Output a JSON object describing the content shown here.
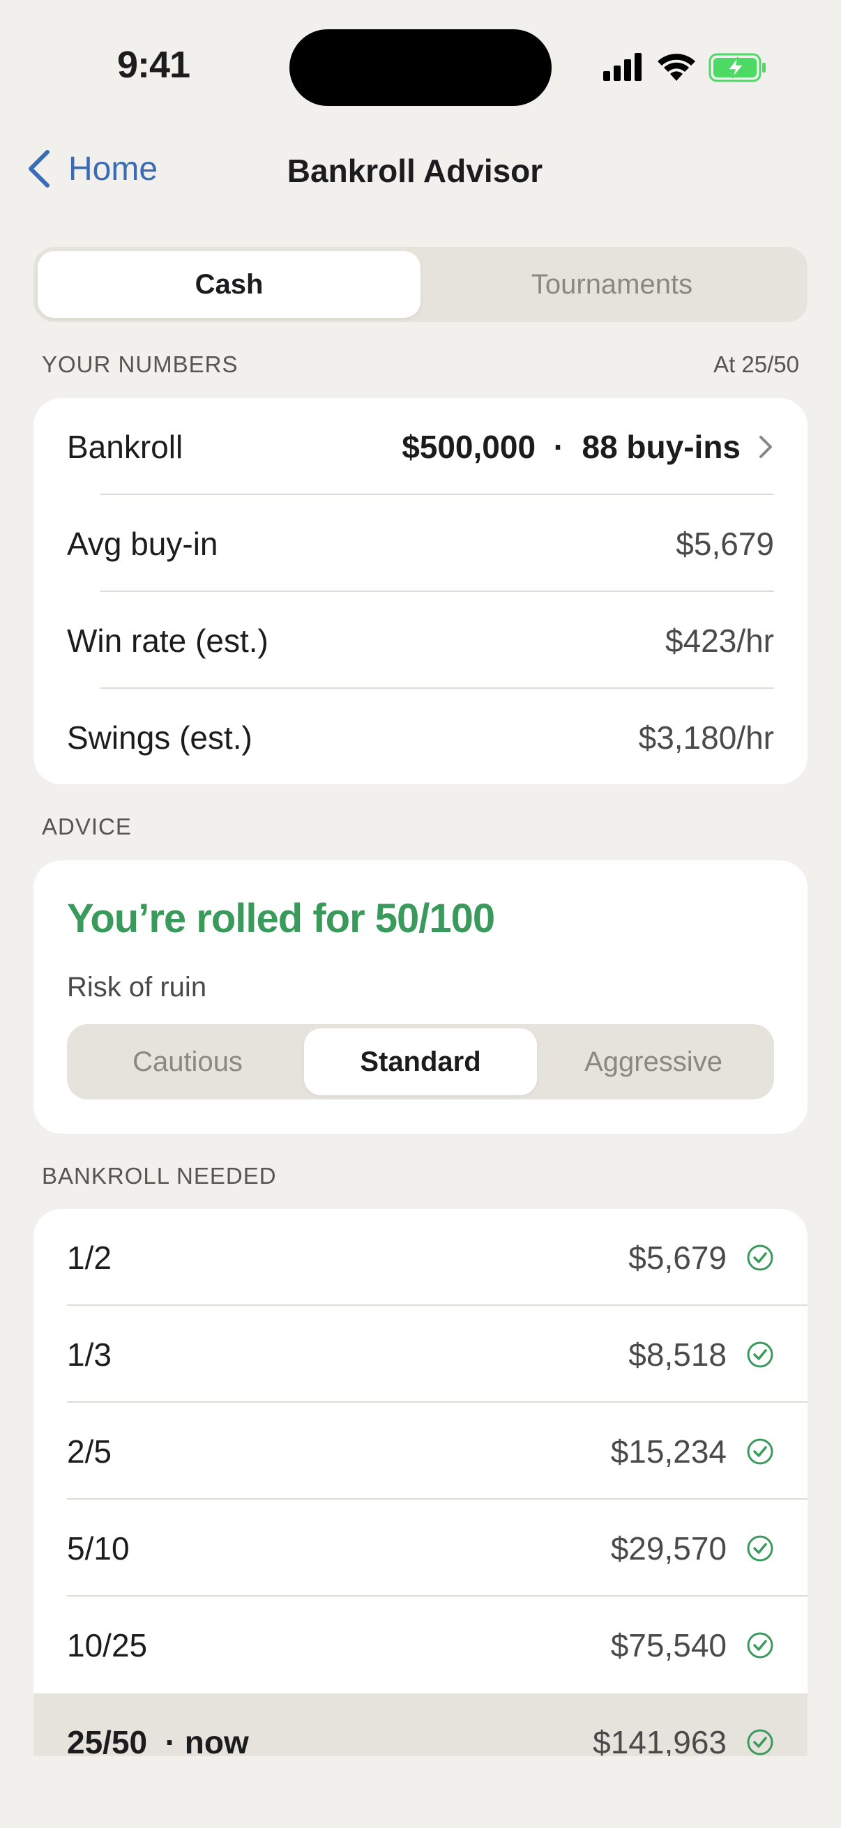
{
  "status_bar": {
    "time": "9:41",
    "icons": [
      "cellular-signal-icon",
      "wifi-icon",
      "battery-charging-icon"
    ],
    "battery_color": "#4cd964"
  },
  "nav": {
    "back_label": "Home",
    "title": "Bankroll Advisor"
  },
  "mode_tabs": [
    {
      "label": "Cash",
      "selected": true
    },
    {
      "label": "Tournaments",
      "selected": false
    }
  ],
  "your_numbers": {
    "header": "YOUR NUMBERS",
    "stakes_note": "At 25/50",
    "rows": [
      {
        "label": "Bankroll",
        "value": "$500,000  ·  88 buy-ins"
      },
      {
        "label": "Avg buy-in",
        "value": "$5,679"
      },
      {
        "label": "Win rate (est.)",
        "value": "$423/hr"
      },
      {
        "label": "Swings (est.)",
        "value": "$3,180/hr"
      }
    ]
  },
  "advice": {
    "header": "ADVICE",
    "headline": "You’re rolled for 50/100",
    "risk_label": "Risk of ruin",
    "risk_options": [
      {
        "label": "Cautious",
        "selected": false
      },
      {
        "label": "Standard",
        "selected": true
      },
      {
        "label": "Aggressive",
        "selected": false
      }
    ]
  },
  "bankroll_needed": {
    "header": "BANKROLL NEEDED",
    "rows": [
      {
        "stakes": "1/2",
        "amount": "$5,679",
        "met": true
      },
      {
        "stakes": "1/3",
        "amount": "$8,518",
        "met": true
      },
      {
        "stakes": "2/5",
        "amount": "$15,234",
        "met": true
      },
      {
        "stakes": "5/10",
        "amount": "$29,570",
        "met": true
      },
      {
        "stakes": "10/25",
        "amount": "$75,540",
        "met": true
      },
      {
        "stakes": "25/50  · now",
        "amount": "$141,963",
        "met": true,
        "current": true
      }
    ]
  },
  "colors": {
    "background": "#f1f0ec",
    "accent_link": "#3a6bb5",
    "success_green": "#3a9a5b",
    "segment_track": "#e6e3dc"
  }
}
